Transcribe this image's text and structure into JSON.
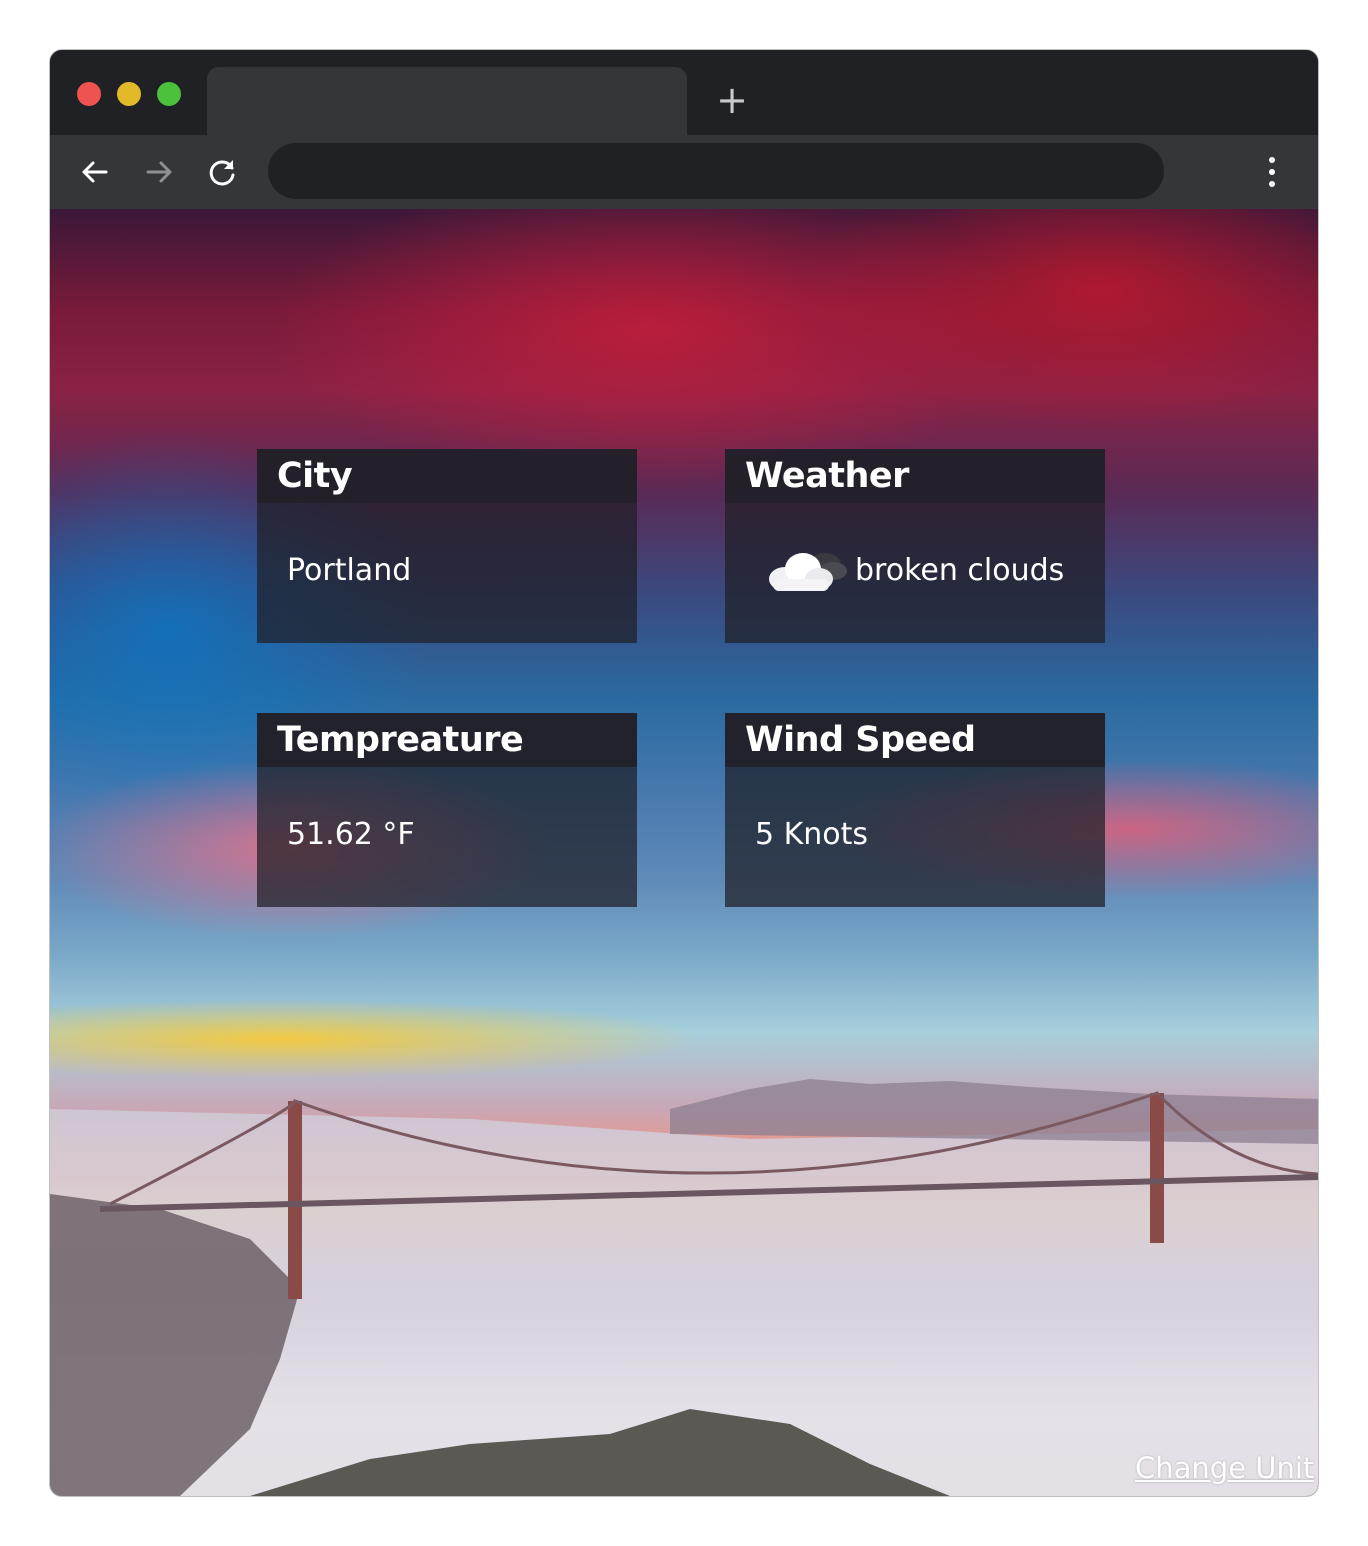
{
  "browser": {
    "new_tab_symbol": "+",
    "traffic_lights": [
      "#ee5350",
      "#e2b928",
      "#4cc13c"
    ]
  },
  "cards": {
    "city": {
      "title": "City",
      "value": "Portland"
    },
    "weather": {
      "title": "Weather",
      "value": "broken clouds",
      "icon": "broken-clouds-icon"
    },
    "temperature": {
      "title": "Tempreature",
      "value": "51.62 °F"
    },
    "wind": {
      "title": "Wind Speed",
      "value": "5 Knots"
    }
  },
  "footer": {
    "change_unit_label": "Change Unit"
  }
}
